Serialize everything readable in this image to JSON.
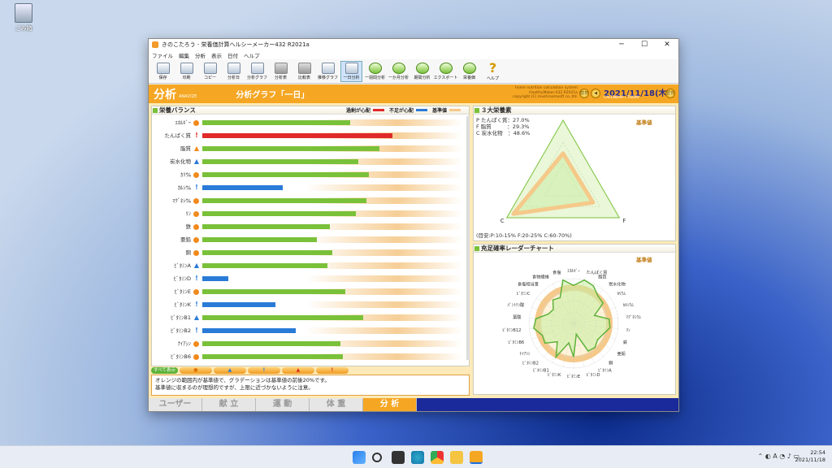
{
  "desktop": {
    "recycle_label": "ごみ箱"
  },
  "window": {
    "title": "きのこたろう - 栄養価計算ヘルシーメーカー432 R2021a",
    "btn_min": "─",
    "btn_max": "☐",
    "btn_close": "✕"
  },
  "menu": [
    "ファイル",
    "編集",
    "分析",
    "表示",
    "日付",
    "ヘルプ"
  ],
  "toolbar": [
    {
      "label": "保存",
      "style": "normal"
    },
    {
      "label": "印刷",
      "style": "normal"
    },
    {
      "label": "コピー",
      "style": "normal"
    },
    {
      "label": "分析日",
      "style": "normal"
    },
    {
      "label": "分析グラフ",
      "style": "normal"
    },
    {
      "label": "分析表",
      "style": "dim"
    },
    {
      "label": "比較表",
      "style": "dim"
    },
    {
      "label": "推移グラフ",
      "style": "normal"
    },
    {
      "label": "一日分析",
      "style": "sel"
    },
    {
      "label": "一週間分析",
      "style": "green"
    },
    {
      "label": "一か月分析",
      "style": "green"
    },
    {
      "label": "期間分析",
      "style": "green"
    },
    {
      "label": "エクスポート",
      "style": "green"
    },
    {
      "label": "栄養価",
      "style": "green"
    },
    {
      "label": "ヘルプ",
      "style": "help"
    }
  ],
  "header": {
    "title": "分析",
    "sub": "ANALYZE",
    "graph_title": "分析グラフ「一日」",
    "info1": "home nutrition calculation system",
    "info2": "HealthyMaker-432 R2021a",
    "info3": "copyright (C) mushroomsoft co.,ltd.",
    "date": "2021/11/18(木)",
    "date_sub": "CALENDAR / TODAY",
    "nav_prev": "前日",
    "nav_next": "翌日"
  },
  "balance": {
    "title": "栄養バランス",
    "legend_excess": "過剰が心配",
    "legend_short": "不足が心配",
    "legend_base": "基準値",
    "colors": {
      "excess": "#e02a2a",
      "short": "#2a7bd8",
      "base": "#f5c98a",
      "normal": "#7ac13a"
    },
    "rows": [
      {
        "label": "ｴﾈﾙｷﾞｰ",
        "mark": "circle",
        "value": 0.57,
        "status": "normal"
      },
      {
        "label": "たんぱく質",
        "mark": "warn",
        "value": 0.73,
        "status": "excess"
      },
      {
        "label": "脂質",
        "mark": "tri-o",
        "value": 0.68,
        "status": "normal"
      },
      {
        "label": "炭水化物",
        "mark": "up",
        "value": 0.6,
        "status": "normal"
      },
      {
        "label": "ｶﾘｳﾑ",
        "mark": "circle",
        "value": 0.64,
        "status": "normal"
      },
      {
        "label": "ｶﾙｼｳﾑ",
        "mark": "warn",
        "value": 0.31,
        "status": "short"
      },
      {
        "label": "ﾏｸﾞﾈｼｳﾑ",
        "mark": "circle",
        "value": 0.63,
        "status": "normal"
      },
      {
        "label": "ﾘﾝ",
        "mark": "circle",
        "value": 0.59,
        "status": "normal"
      },
      {
        "label": "鉄",
        "mark": "circle",
        "value": 0.49,
        "status": "normal"
      },
      {
        "label": "亜鉛",
        "mark": "circle",
        "value": 0.44,
        "status": "normal"
      },
      {
        "label": "銅",
        "mark": "circle",
        "value": 0.5,
        "status": "normal"
      },
      {
        "label": "ﾋﾞﾀﾐﾝA",
        "mark": "up",
        "value": 0.48,
        "status": "normal"
      },
      {
        "label": "ﾋﾞﾀﾐﾝD",
        "mark": "warn",
        "value": 0.1,
        "status": "short"
      },
      {
        "label": "ﾋﾞﾀﾐﾝE",
        "mark": "circle",
        "value": 0.55,
        "status": "normal"
      },
      {
        "label": "ﾋﾞﾀﾐﾝK",
        "mark": "warn",
        "value": 0.28,
        "status": "short"
      },
      {
        "label": "ﾋﾞﾀﾐﾝB1",
        "mark": "up",
        "value": 0.62,
        "status": "normal"
      },
      {
        "label": "ﾋﾞﾀﾐﾝB2",
        "mark": "warn",
        "value": 0.36,
        "status": "short"
      },
      {
        "label": "ﾅｲｱｼﾝ",
        "mark": "circle",
        "value": 0.53,
        "status": "normal"
      },
      {
        "label": "ﾋﾞﾀﾐﾝB6",
        "mark": "circle",
        "value": 0.54,
        "status": "normal"
      }
    ]
  },
  "filters": {
    "all": "すべて表示",
    "buttons": [
      "●",
      "▲",
      "!",
      "▲",
      "!"
    ]
  },
  "note": {
    "line1": "オレンジの範囲内が基準値で、グラデーションは基準値の前後20%です。",
    "line2": "基準値に収まるのが理想的ですが、上限に近づかないように注意。"
  },
  "pfc": {
    "title": "３大栄養素",
    "p_label": "P たんぱく質：27.0%",
    "f_label": "F 脂質　　　：29.3%",
    "c_label": "C 炭水化物　：48.6%",
    "base": "基準値",
    "vertex_p": "P",
    "vertex_f": "F",
    "vertex_c": "C",
    "guide": "(目安:P:10-15% F:20-25% C:60-70%)",
    "values": {
      "p": 27.0,
      "f": 29.3,
      "c": 48.6
    }
  },
  "radar": {
    "title": "充足確率レーダーチャート",
    "base": "基準値",
    "axes": [
      "ｴﾈﾙｷﾞｰ",
      "たんぱく質",
      "脂質",
      "炭水化物",
      "ｶﾘｳﾑ",
      "ｶﾙｼｳﾑ",
      "ﾏｸﾞﾈｼｳﾑ",
      "ﾘﾝ",
      "鉄",
      "亜鉛",
      "銅",
      "ﾋﾞﾀﾐﾝA",
      "ﾋﾞﾀﾐﾝD",
      "ﾋﾞﾀﾐﾝE",
      "ﾋﾞﾀﾐﾝK",
      "ﾋﾞﾀﾐﾝB1",
      "ﾋﾞﾀﾐﾝB2",
      "ﾅｲｱｼﾝ",
      "ﾋﾞﾀﾐﾝB6",
      "ﾋﾞﾀﾐﾝB12",
      "葉酸",
      "ﾊﾟﾝﾄﾃﾝ酸",
      "ﾋﾞﾀﾐﾝC",
      "食塩相当量",
      "食物繊維",
      "食塩"
    ],
    "values": [
      0.85,
      1.0,
      0.95,
      0.82,
      0.8,
      0.5,
      0.8,
      0.82,
      0.7,
      0.65,
      0.72,
      0.7,
      0.25,
      0.75,
      0.45,
      0.85,
      0.55,
      0.78,
      0.75,
      0.9,
      0.85,
      0.6,
      0.55,
      0.7,
      0.65,
      1.0
    ]
  },
  "tabs": [
    "ユーザー",
    "献 立",
    "運 動",
    "体 重",
    "分 析"
  ],
  "tray": {
    "time": "22:54",
    "date": "2021/11/18",
    "ime": "A"
  }
}
